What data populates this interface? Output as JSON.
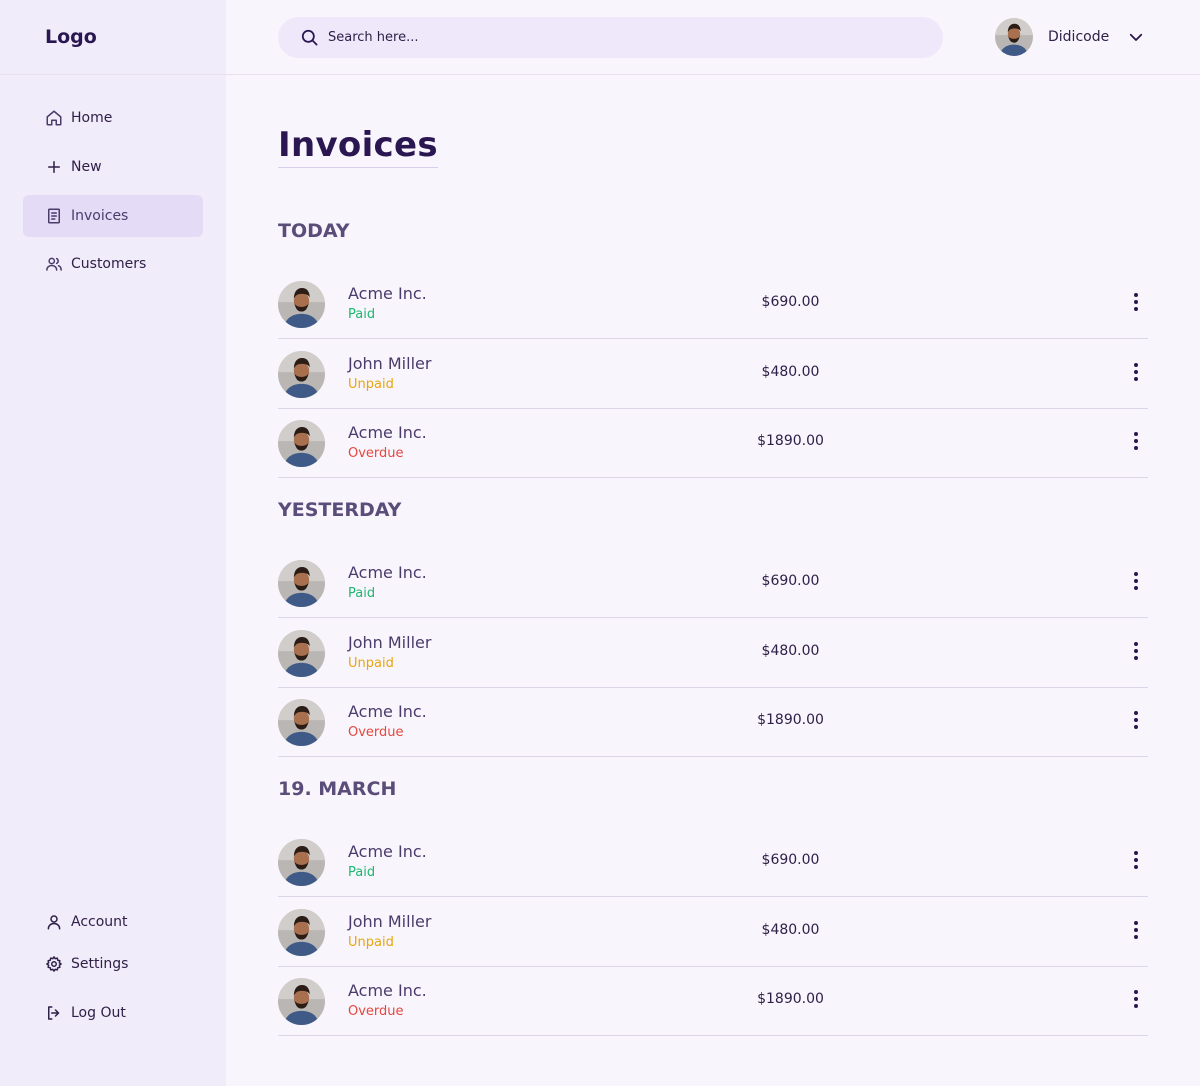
{
  "colors": {
    "paid": "#1fb66e",
    "unpaid": "#e8a60c",
    "overdue": "#e2483d",
    "accent": "#2a1650",
    "active_nav_bg": "#e4dbf6"
  },
  "sidebar": {
    "logo": "Logo",
    "nav": [
      {
        "label": "Home",
        "icon": "home-icon"
      },
      {
        "label": "New",
        "icon": "plus-icon"
      },
      {
        "label": "Invoices",
        "icon": "document-icon",
        "active": true
      },
      {
        "label": "Customers",
        "icon": "users-icon"
      }
    ],
    "bottom": [
      {
        "label": "Account",
        "icon": "user-icon"
      },
      {
        "label": "Settings",
        "icon": "gear-icon"
      },
      {
        "label": "Log Out",
        "icon": "logout-icon"
      }
    ]
  },
  "header": {
    "search_placeholder": "Search here...",
    "username": "Didicode"
  },
  "main": {
    "title": "Invoices",
    "sections": [
      {
        "title": "TODAY",
        "rows": [
          {
            "name": "Acme Inc.",
            "status": "Paid",
            "amount": "$690.00"
          },
          {
            "name": "John Miller",
            "status": "Unpaid",
            "amount": "$480.00"
          },
          {
            "name": "Acme Inc.",
            "status": "Overdue",
            "amount": "$1890.00"
          }
        ]
      },
      {
        "title": "YESTERDAY",
        "rows": [
          {
            "name": "Acme Inc.",
            "status": "Paid",
            "amount": "$690.00"
          },
          {
            "name": "John Miller",
            "status": "Unpaid",
            "amount": "$480.00"
          },
          {
            "name": "Acme Inc.",
            "status": "Overdue",
            "amount": "$1890.00"
          }
        ]
      },
      {
        "title": "19. MARCH",
        "rows": [
          {
            "name": "Acme Inc.",
            "status": "Paid",
            "amount": "$690.00"
          },
          {
            "name": "John Miller",
            "status": "Unpaid",
            "amount": "$480.00"
          },
          {
            "name": "Acme Inc.",
            "status": "Overdue",
            "amount": "$1890.00"
          }
        ]
      }
    ]
  }
}
